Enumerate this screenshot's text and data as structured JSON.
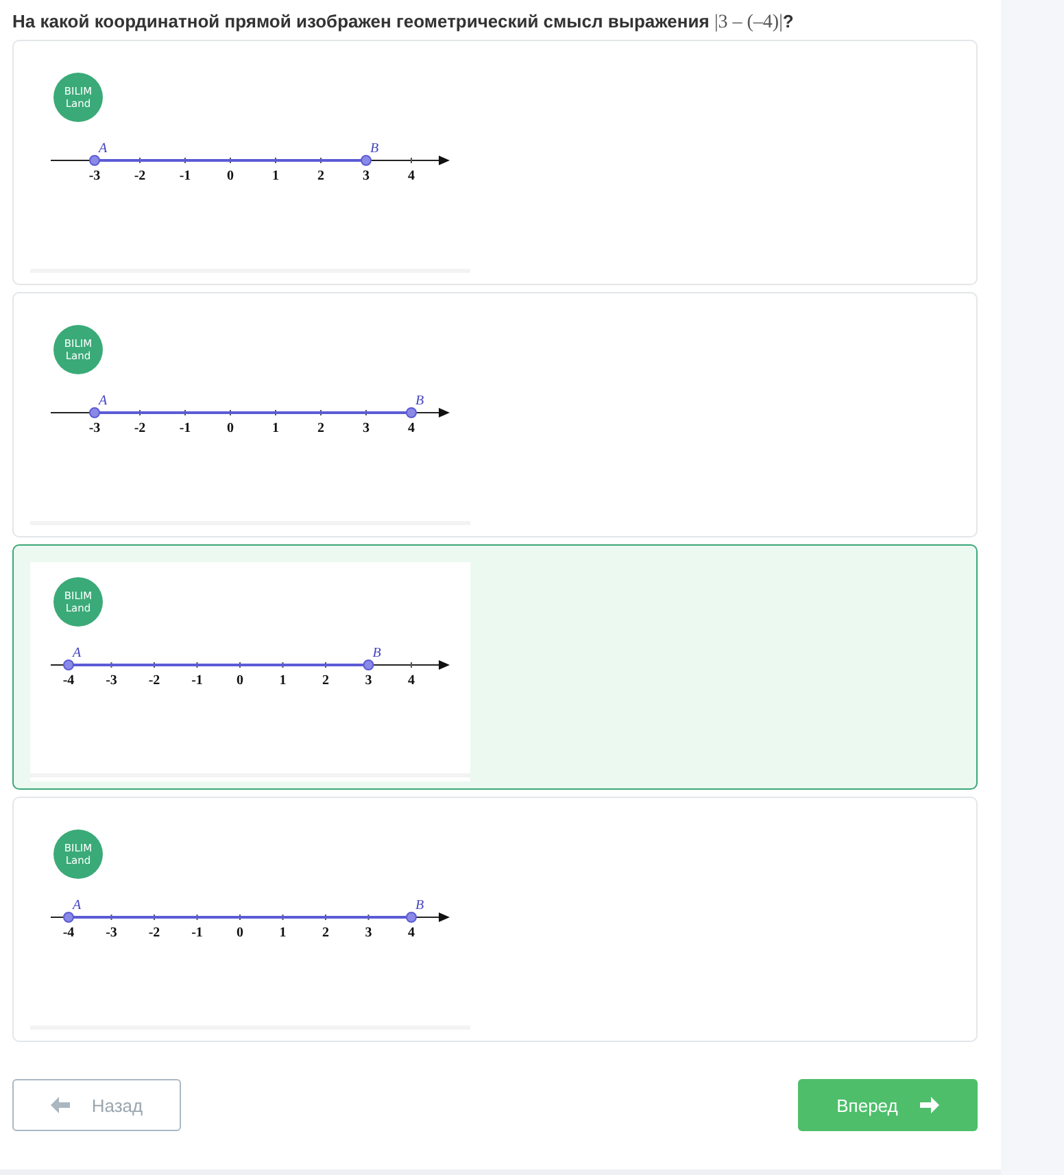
{
  "question": {
    "text": "На какой координатной прямой изображен геометрический смысл выражения",
    "expression": "|3 – (–4)|",
    "end": "?"
  },
  "options": [
    {
      "selected": false,
      "logo": [
        "BILIM",
        "Land"
      ],
      "ticks": [
        {
          "label": "-3",
          "point": "A"
        },
        {
          "label": "-2"
        },
        {
          "label": "-1"
        },
        {
          "label": "0"
        },
        {
          "label": "1"
        },
        {
          "label": "2"
        },
        {
          "label": "3",
          "point": "B"
        },
        {
          "label": "4"
        }
      ]
    },
    {
      "selected": false,
      "logo": [
        "BILIM",
        "Land"
      ],
      "ticks": [
        {
          "label": "-3",
          "point": "A"
        },
        {
          "label": "-2"
        },
        {
          "label": "-1"
        },
        {
          "label": "0"
        },
        {
          "label": "1"
        },
        {
          "label": "2"
        },
        {
          "label": "3"
        },
        {
          "label": "4",
          "point": "B"
        }
      ]
    },
    {
      "selected": true,
      "logo": [
        "BILIM",
        "Land"
      ],
      "ticks": [
        {
          "label": "-4",
          "point": "A"
        },
        {
          "label": "-3"
        },
        {
          "label": "-2"
        },
        {
          "label": "-1"
        },
        {
          "label": "0"
        },
        {
          "label": "1"
        },
        {
          "label": "2"
        },
        {
          "label": "3",
          "point": "B"
        },
        {
          "label": "4"
        }
      ]
    },
    {
      "selected": false,
      "logo": [
        "BILIM",
        "Land"
      ],
      "ticks": [
        {
          "label": "-4",
          "point": "A"
        },
        {
          "label": "-3"
        },
        {
          "label": "-2"
        },
        {
          "label": "-1"
        },
        {
          "label": "0"
        },
        {
          "label": "1"
        },
        {
          "label": "2"
        },
        {
          "label": "3"
        },
        {
          "label": "4",
          "point": "B"
        }
      ]
    }
  ],
  "buttons": {
    "back": "Назад",
    "next": "Вперед"
  }
}
